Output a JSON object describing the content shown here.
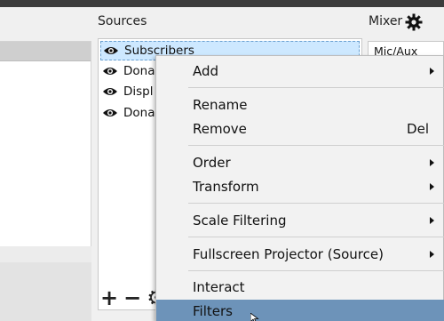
{
  "sources": {
    "title": "Sources",
    "items": [
      {
        "label": "Subscribers",
        "icon": "eye-icon",
        "selected": true
      },
      {
        "label": "Dona",
        "icon": "eye-icon",
        "selected": false
      },
      {
        "label": "Displ",
        "icon": "eye-icon",
        "selected": false
      },
      {
        "label": "Dona",
        "icon": "eye-icon",
        "selected": false
      }
    ],
    "toolbar": {
      "add": "+",
      "remove": "−",
      "settings": "⚙"
    }
  },
  "mixer": {
    "title": "Mixer",
    "gear_icon": "gear-icon",
    "track_label": "Mic/Aux"
  },
  "context_menu": {
    "items": [
      {
        "label": "Add",
        "submenu": true
      },
      {
        "label": "Rename"
      },
      {
        "label": "Remove",
        "shortcut": "Del"
      },
      {
        "label": "Order",
        "submenu": true
      },
      {
        "label": "Transform",
        "submenu": true
      },
      {
        "label": "Scale Filtering",
        "submenu": true
      },
      {
        "label": "Fullscreen Projector (Source)",
        "submenu": true
      },
      {
        "label": "Interact"
      },
      {
        "label": "Filters",
        "highlighted": true
      }
    ]
  },
  "colors": {
    "selection": "#cde8ff",
    "menu_highlight": "#6d93b9",
    "menu_bg": "#f2f2f2"
  }
}
